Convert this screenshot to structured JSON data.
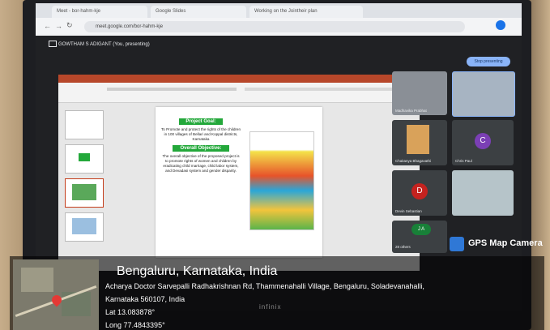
{
  "browser": {
    "tabs": [
      "Meet - bor-hahm-kje",
      "Google Slides",
      "Working on the Jointheir plan"
    ],
    "url": "meet.google.com/bor-hahm-kje"
  },
  "meet": {
    "presenting_label": "GOWTHAM S ADIGANT (You, presenting)",
    "stop_presenting": "Stop presenting",
    "participants": [
      {
        "name": "Madhavika Prabhat",
        "avatar": ""
      },
      {
        "name": "",
        "avatar": ""
      },
      {
        "name": "Chaitanya Bhagavathi",
        "avatar": ""
      },
      {
        "name": "Chris Paul",
        "avatar": "C"
      },
      {
        "name": "Devin Sebastian",
        "avatar": "D"
      },
      {
        "name": "",
        "avatar": ""
      },
      {
        "name": "28 others",
        "avatar": "J A"
      }
    ]
  },
  "slide": {
    "goal_heading": "Project Goal:",
    "goal_text": "To Promote and protect the rights of the children in 100 villages of Bellari and Koppal districts, Karnataka",
    "objective_heading": "Overall Objective:",
    "objective_text": "The overall objective of the proposed project is to promote rights of women and children by eradicating child marriage, child labor system, and Devadasi system and gender disparity."
  },
  "gps": {
    "app_label": "GPS Map Camera",
    "title": "Bengaluru, Karnataka, India",
    "address_line1": "Acharya Doctor Sarvepalli Radhakrishnan Rd, Thammenahalli Village, Bengaluru, Soladevanahalli,",
    "address_line2": "Karnataka 560107, India",
    "lat": "Lat 13.083878°",
    "long": "Long 77.4843395°"
  },
  "device": {
    "brand": "infinix"
  },
  "colors": {
    "accent_green": "#23a83a",
    "ppt_red": "#b7472a",
    "meet_bg": "#202124",
    "button_blue": "#8ab4f8"
  }
}
